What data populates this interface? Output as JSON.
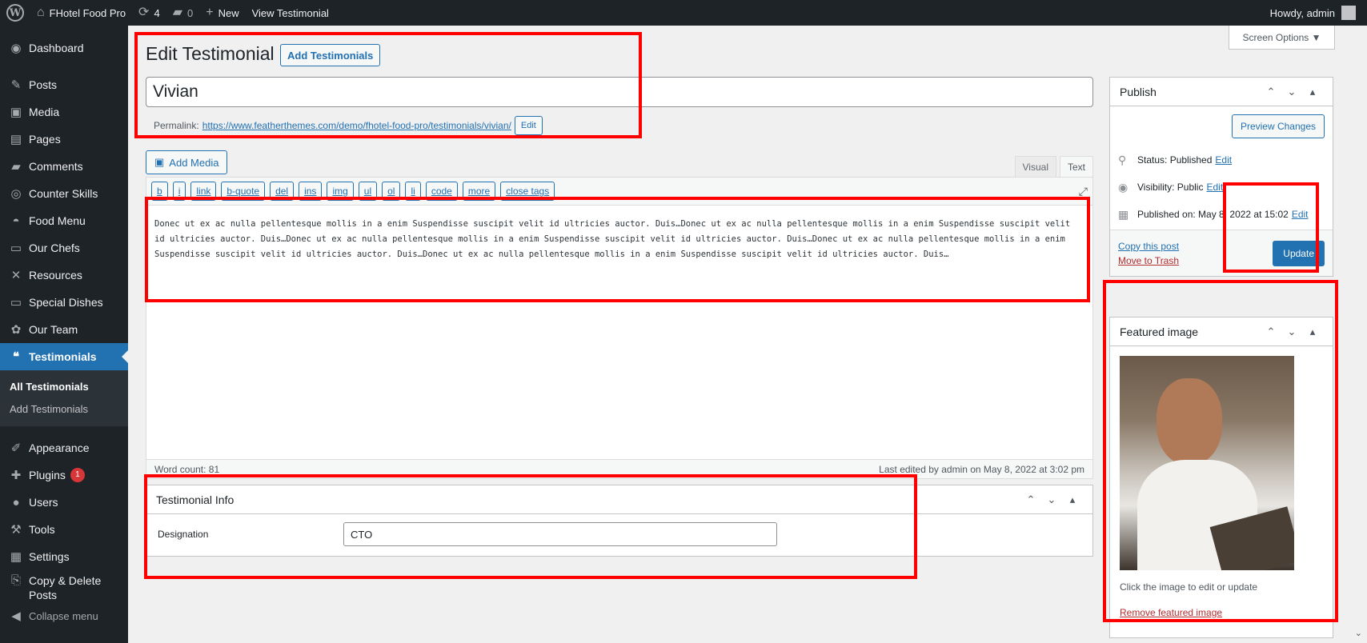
{
  "adminbar": {
    "site_name": "FHotel Food Pro",
    "updates_count": "4",
    "comments_count": "0",
    "new_label": "New",
    "view_label": "View Testimonial",
    "greeting": "Howdy, admin"
  },
  "sidebar": {
    "items": [
      {
        "label": "Dashboard",
        "icon": "dashboard-icon"
      },
      {
        "label": "Posts",
        "icon": "pin-icon"
      },
      {
        "label": "Media",
        "icon": "media-icon"
      },
      {
        "label": "Pages",
        "icon": "page-icon"
      },
      {
        "label": "Comments",
        "icon": "comment-icon"
      },
      {
        "label": "Counter Skills",
        "icon": "gauge-icon"
      },
      {
        "label": "Food Menu",
        "icon": "food-icon"
      },
      {
        "label": "Our Chefs",
        "icon": "monitor-icon"
      },
      {
        "label": "Resources",
        "icon": "tools-icon"
      },
      {
        "label": "Special Dishes",
        "icon": "monitor-icon"
      },
      {
        "label": "Our Team",
        "icon": "team-icon"
      },
      {
        "label": "Testimonials",
        "icon": "quote-icon"
      }
    ],
    "submenu": [
      "All Testimonials",
      "Add Testimonials"
    ],
    "items_bottom": [
      {
        "label": "Appearance",
        "icon": "brush-icon"
      },
      {
        "label": "Plugins",
        "icon": "plugin-icon",
        "badge": "1"
      },
      {
        "label": "Users",
        "icon": "user-icon"
      },
      {
        "label": "Tools",
        "icon": "wrench-icon"
      },
      {
        "label": "Settings",
        "icon": "settings-icon"
      },
      {
        "label": "Copy & Delete Posts",
        "icon": "copy-icon"
      }
    ],
    "collapse_label": "Collapse menu"
  },
  "screen_options": "Screen Options ▼",
  "page": {
    "title": "Edit Testimonial",
    "add_button": "Add Testimonials",
    "post_title": "Vivian",
    "permalink_label": "Permalink:",
    "permalink_url": "https://www.featherthemes.com/demo/fhotel-food-pro/testimonials/vivian/",
    "edit_button": "Edit"
  },
  "editor": {
    "add_media": "Add Media",
    "tab_visual": "Visual",
    "tab_text": "Text",
    "quicktags": [
      "b",
      "i",
      "link",
      "b-quote",
      "del",
      "ins",
      "img",
      "ul",
      "ol",
      "li",
      "code",
      "more",
      "close tags"
    ],
    "content": "Donec ut ex ac nulla pellentesque mollis in a enim Suspendisse suscipit velit id ultricies auctor. Duis…Donec ut ex ac nulla pellentesque mollis in a enim Suspendisse suscipit velit id ultricies auctor. Duis…Donec ut ex ac nulla pellentesque mollis in a enim Suspendisse suscipit velit id ultricies auctor. Duis…Donec ut ex ac nulla pellentesque mollis in a enim Suspendisse suscipit velit id ultricies auctor. Duis…Donec ut ex ac nulla pellentesque mollis in a enim Suspendisse suscipit velit id ultricies auctor. Duis…",
    "word_count": "Word count: 81",
    "last_edited": "Last edited by admin on May 8, 2022 at 3:02 pm"
  },
  "testimonial_info": {
    "title": "Testimonial Info",
    "designation_label": "Designation",
    "designation_value": "CTO"
  },
  "publish": {
    "title": "Publish",
    "preview": "Preview Changes",
    "status": "Status: Published",
    "visibility": "Visibility: Public",
    "published_on": "Published on: May 8, 2022 at 15:02",
    "edit": "Edit",
    "copy_post": "Copy this post",
    "trash": "Move to Trash",
    "update": "Update"
  },
  "featured": {
    "title": "Featured image",
    "hint": "Click the image to edit or update",
    "remove": "Remove featured image"
  },
  "colors": {
    "admin_dark": "#1d2327",
    "accent": "#2271b1",
    "highlight": "#ff0000"
  }
}
